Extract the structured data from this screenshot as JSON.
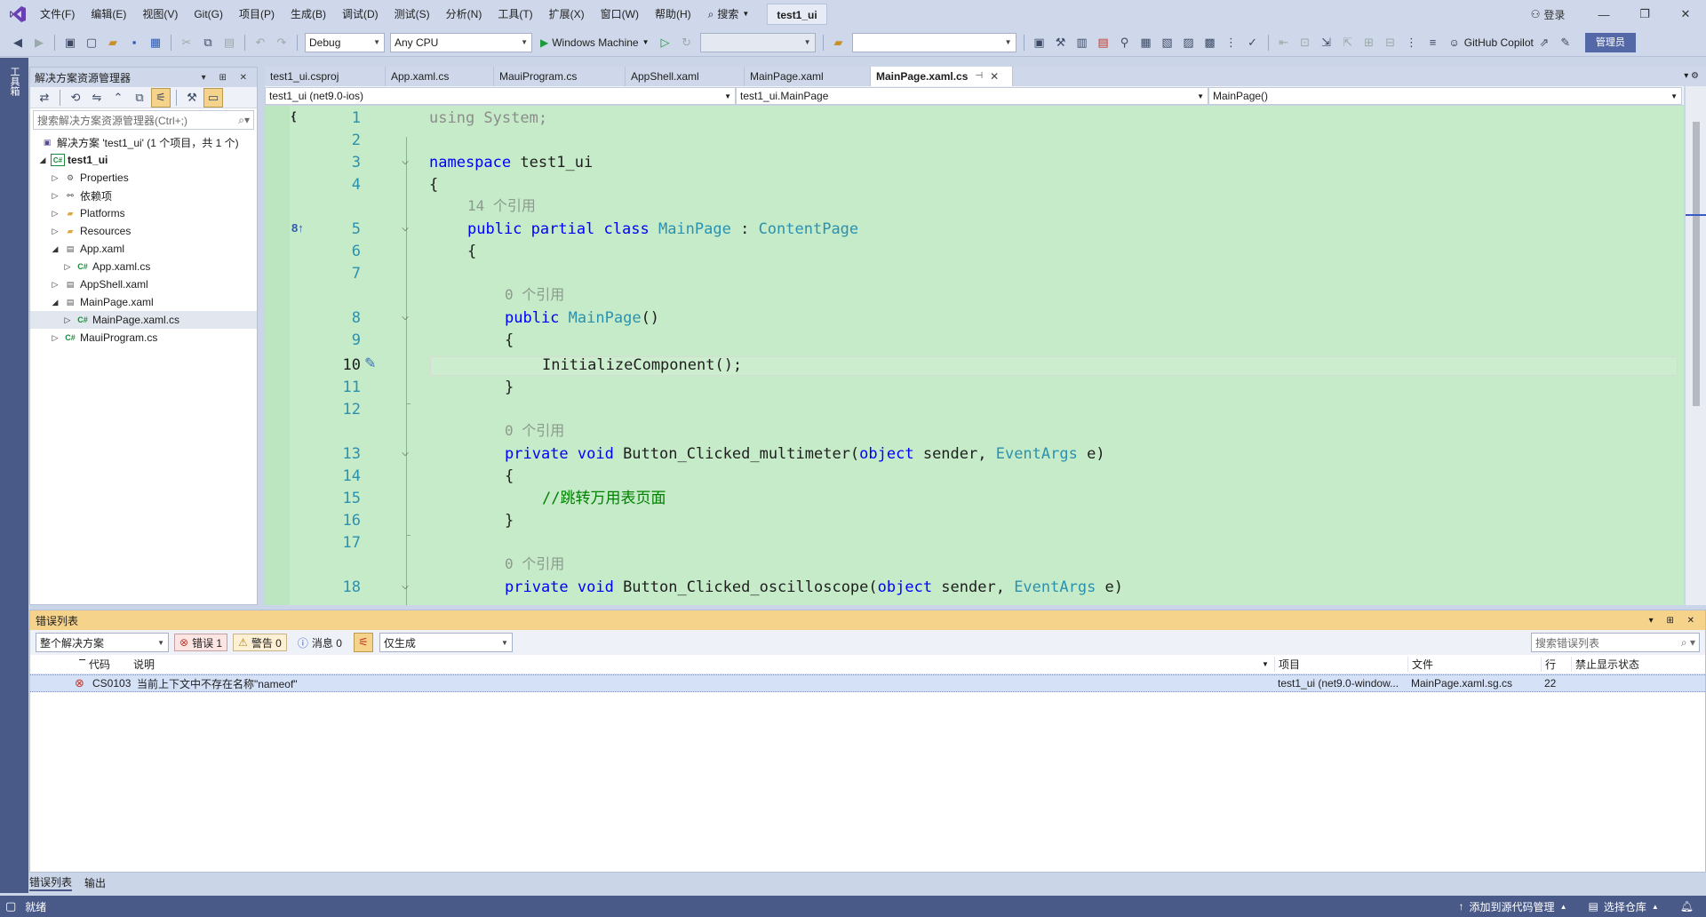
{
  "menubar": {
    "items": [
      "文件(F)",
      "编辑(E)",
      "视图(V)",
      "Git(G)",
      "项目(P)",
      "生成(B)",
      "调试(D)",
      "测试(S)",
      "分析(N)",
      "工具(T)",
      "扩展(X)",
      "窗口(W)",
      "帮助(H)"
    ],
    "search_label": "搜索",
    "project_title": "test1_ui",
    "login_label": "登录"
  },
  "toolbar": {
    "config": "Debug",
    "platform": "Any CPU",
    "run_target": "Windows Machine",
    "copilot_label": "GitHub Copilot",
    "admin_label": "管理员"
  },
  "left_strip": {
    "label": "工具箱"
  },
  "solution_explorer": {
    "title": "解决方案资源管理器",
    "search_placeholder": "搜索解决方案资源管理器(Ctrl+;)",
    "solution_label": "解决方案 'test1_ui' (1 个项目，共 1 个)",
    "project": "test1_ui",
    "items": [
      {
        "label": "Properties"
      },
      {
        "label": "依赖项"
      },
      {
        "label": "Platforms"
      },
      {
        "label": "Resources"
      },
      {
        "label": "App.xaml"
      },
      {
        "label": "App.xaml.cs"
      },
      {
        "label": "AppShell.xaml"
      },
      {
        "label": "MainPage.xaml"
      },
      {
        "label": "MainPage.xaml.cs"
      },
      {
        "label": "MauiProgram.cs"
      }
    ]
  },
  "tabs": [
    {
      "label": "test1_ui.csproj"
    },
    {
      "label": "App.xaml.cs"
    },
    {
      "label": "MauiProgram.cs"
    },
    {
      "label": "AppShell.xaml"
    },
    {
      "label": "MainPage.xaml"
    },
    {
      "label": "MainPage.xaml.cs"
    }
  ],
  "navbar": {
    "project": "test1_ui (net9.0-ios)",
    "type": "test1_ui.MainPage",
    "member": "MainPage()"
  },
  "code": {
    "lines": [
      "1",
      "2",
      "3",
      "4",
      "5",
      "6",
      "7",
      "8",
      "9",
      "10",
      "11",
      "12",
      "13",
      "14",
      "15",
      "16",
      "17",
      "18"
    ],
    "using_kw": "using",
    "using_rest": " System;",
    "namespace_kw": "namespace",
    "namespace_name": " test1_ui",
    "brace_open": "{",
    "brace_close": "}",
    "ref_14": "14 个引用",
    "ref_0": "0 个引用",
    "class_mods": "public partial class",
    "class_name": "MainPage",
    "class_colon": " : ",
    "base_class": "ContentPage",
    "ctor_kw": "public",
    "ctor_name": "MainPage",
    "ctor_parens": "()",
    "init_call": "InitializeComponent();",
    "method1_mods": "private void",
    "method1_name": " Button_Clicked_multimeter(",
    "obj_kw": "object",
    "sender": " sender, ",
    "eventargs": "EventArgs",
    "e_close": " e)",
    "comment1": "//跳转万用表页面",
    "method2_name": " Button_Clicked_oscilloscope("
  },
  "error_list": {
    "title": "错误列表",
    "scope": "整个解决方案",
    "errors_label": "错误 1",
    "warnings_label": "警告 0",
    "messages_label": "消息 0",
    "filter": "仅生成",
    "search_placeholder": "搜索错误列表",
    "columns": {
      "code": "代码",
      "desc": "说明",
      "project": "项目",
      "file": "文件",
      "line": "行",
      "suppress": "禁止显示状态"
    },
    "rows": [
      {
        "code": "CS0103",
        "desc": "当前上下文中不存在名称\"nameof\"",
        "project": "test1_ui (net9.0-window...",
        "file": "MainPage.xaml.sg.cs",
        "line": "22",
        "suppress": ""
      }
    ]
  },
  "bottom_tabs": [
    "错误列表",
    "输出"
  ],
  "status": {
    "ready": "就绪",
    "add_source": "添加到源代码管理",
    "select_repo": "选择仓库"
  },
  "colors": {
    "keyword": "#0000ff",
    "type": "#2b91af",
    "comment": "#008000",
    "editor_bg": "#c6ebc9",
    "chrome": "#cfd8ea",
    "status": "#4a5a88"
  }
}
